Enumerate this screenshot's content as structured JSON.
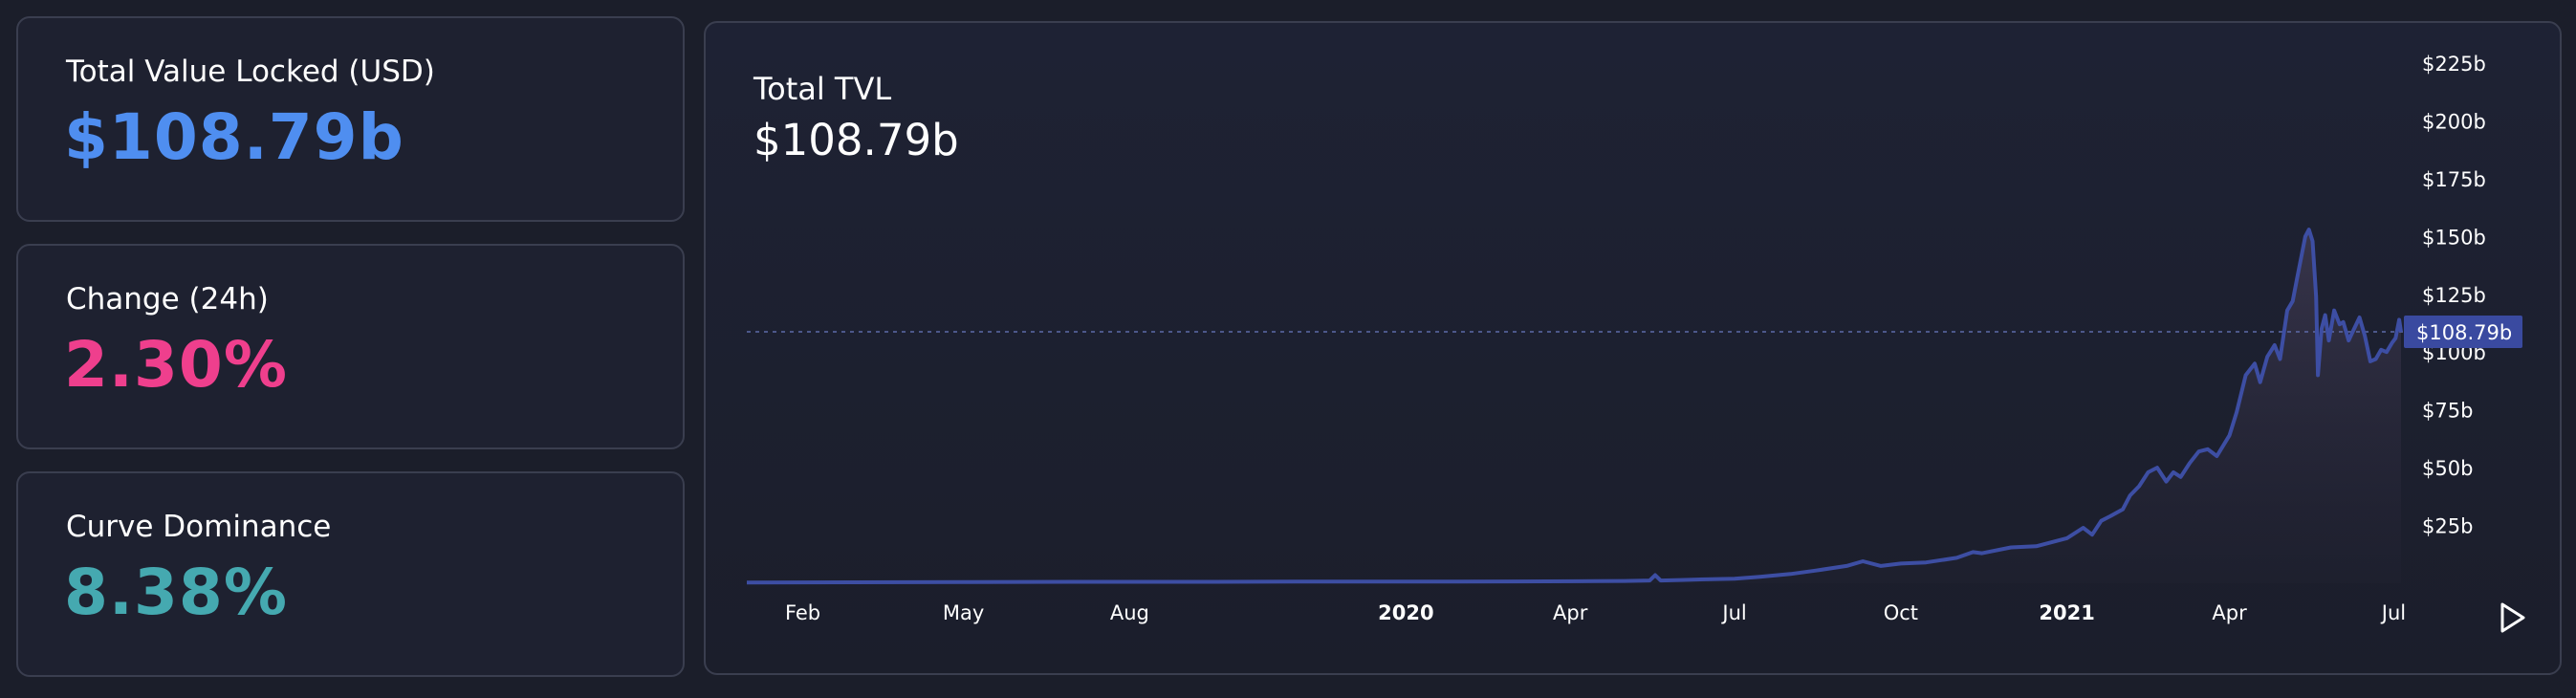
{
  "stats": {
    "tvl_label": "Total Value Locked (USD)",
    "tvl_value": "$108.79b",
    "change_label": "Change (24h)",
    "change_value": "2.30%",
    "dominance_label": "Curve Dominance",
    "dominance_value": "8.38%"
  },
  "colors": {
    "tvl": "#4f8ef0",
    "change": "#ef3f8d",
    "dominance": "#45a9b0",
    "line": "#3d4ea3",
    "price_tag": "#3a4aa0"
  },
  "chart": {
    "title": "Total TVL",
    "value": "$108.79b",
    "current_label": "$108.79b",
    "play_icon": "play-icon"
  },
  "chart_data": {
    "type": "area",
    "title": "Total TVL",
    "xlabel": "",
    "ylabel": "",
    "ylim": [
      0,
      225
    ],
    "y_unit": "$b",
    "y_ticks": [
      25,
      50,
      75,
      100,
      125,
      150,
      175,
      200,
      225
    ],
    "y_tick_labels": [
      "$25b",
      "$50b",
      "$75b",
      "$100b",
      "$125b",
      "$150b",
      "$175b",
      "$200b",
      "$225b"
    ],
    "x_ticks": [
      {
        "date": "2019-02-01",
        "label": "Feb",
        "bold": false
      },
      {
        "date": "2019-05-01",
        "label": "May",
        "bold": false
      },
      {
        "date": "2019-08-01",
        "label": "Aug",
        "bold": false
      },
      {
        "date": "2020-01-01",
        "label": "2020",
        "bold": true
      },
      {
        "date": "2020-04-01",
        "label": "Apr",
        "bold": false
      },
      {
        "date": "2020-07-01",
        "label": "Jul",
        "bold": false
      },
      {
        "date": "2020-10-01",
        "label": "Oct",
        "bold": false
      },
      {
        "date": "2021-01-01",
        "label": "2021",
        "bold": true
      },
      {
        "date": "2021-04-01",
        "label": "Apr",
        "bold": false
      },
      {
        "date": "2021-07-01",
        "label": "Jul",
        "bold": false
      }
    ],
    "grid": false,
    "legend": "none",
    "current_value": 108.79,
    "series": [
      {
        "points": [
          [
            "2019-01-01",
            0.3
          ],
          [
            "2019-03-01",
            0.4
          ],
          [
            "2019-05-01",
            0.5
          ],
          [
            "2019-07-01",
            0.6
          ],
          [
            "2019-09-01",
            0.6
          ],
          [
            "2019-11-01",
            0.7
          ],
          [
            "2020-01-01",
            0.7
          ],
          [
            "2020-03-01",
            0.8
          ],
          [
            "2020-04-15",
            0.9
          ],
          [
            "2020-05-01",
            1.0
          ],
          [
            "2020-05-15",
            1.2
          ],
          [
            "2020-05-18",
            3.5
          ],
          [
            "2020-05-21",
            1.2
          ],
          [
            "2020-06-01",
            1.4
          ],
          [
            "2020-06-15",
            1.7
          ],
          [
            "2020-07-01",
            2.0
          ],
          [
            "2020-07-15",
            2.8
          ],
          [
            "2020-08-01",
            4.0
          ],
          [
            "2020-08-15",
            5.5
          ],
          [
            "2020-09-01",
            7.5
          ],
          [
            "2020-09-10",
            9.5
          ],
          [
            "2020-09-20",
            7.5
          ],
          [
            "2020-10-01",
            8.5
          ],
          [
            "2020-10-15",
            9.0
          ],
          [
            "2020-11-01",
            11.0
          ],
          [
            "2020-11-10",
            13.5
          ],
          [
            "2020-11-15",
            13.0
          ],
          [
            "2020-12-01",
            15.5
          ],
          [
            "2020-12-15",
            16.0
          ],
          [
            "2021-01-01",
            19.5
          ],
          [
            "2021-01-10",
            24.0
          ],
          [
            "2021-01-15",
            21.0
          ],
          [
            "2021-01-20",
            27.0
          ],
          [
            "2021-01-25",
            29.0
          ],
          [
            "2021-02-01",
            32.0
          ],
          [
            "2021-02-05",
            38.0
          ],
          [
            "2021-02-10",
            42.0
          ],
          [
            "2021-02-15",
            48.0
          ],
          [
            "2021-02-20",
            50.0
          ],
          [
            "2021-02-25",
            44.0
          ],
          [
            "2021-03-01",
            48.0
          ],
          [
            "2021-03-05",
            46.0
          ],
          [
            "2021-03-10",
            52.0
          ],
          [
            "2021-03-15",
            57.0
          ],
          [
            "2021-03-20",
            58.0
          ],
          [
            "2021-03-25",
            55.0
          ],
          [
            "2021-04-01",
            64.0
          ],
          [
            "2021-04-05",
            74.0
          ],
          [
            "2021-04-10",
            90.0
          ],
          [
            "2021-04-15",
            95.0
          ],
          [
            "2021-04-18",
            87.0
          ],
          [
            "2021-04-22",
            98.0
          ],
          [
            "2021-04-26",
            103.0
          ],
          [
            "2021-04-29",
            97.0
          ],
          [
            "2021-05-03",
            118.0
          ],
          [
            "2021-05-06",
            122.0
          ],
          [
            "2021-05-09",
            134.0
          ],
          [
            "2021-05-11",
            142.0
          ],
          [
            "2021-05-13",
            150.0
          ],
          [
            "2021-05-15",
            153.0
          ],
          [
            "2021-05-17",
            148.0
          ],
          [
            "2021-05-19",
            124.0
          ],
          [
            "2021-05-20",
            90.0
          ],
          [
            "2021-05-22",
            110.0
          ],
          [
            "2021-05-24",
            116.0
          ],
          [
            "2021-05-26",
            105.0
          ],
          [
            "2021-05-29",
            118.0
          ],
          [
            "2021-06-01",
            112.0
          ],
          [
            "2021-06-03",
            113.0
          ],
          [
            "2021-06-06",
            105.0
          ],
          [
            "2021-06-09",
            110.0
          ],
          [
            "2021-06-12",
            115.0
          ],
          [
            "2021-06-15",
            107.0
          ],
          [
            "2021-06-18",
            96.0
          ],
          [
            "2021-06-21",
            97.0
          ],
          [
            "2021-06-24",
            101.0
          ],
          [
            "2021-06-27",
            100.0
          ],
          [
            "2021-06-30",
            104.0
          ],
          [
            "2021-07-02",
            106.0
          ],
          [
            "2021-07-04",
            114.0
          ],
          [
            "2021-07-05",
            108.79
          ]
        ]
      }
    ]
  }
}
